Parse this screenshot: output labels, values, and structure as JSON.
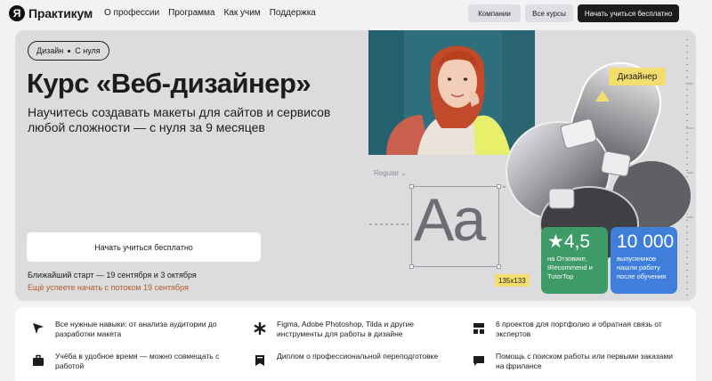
{
  "header": {
    "logo_mark": "Я",
    "logo_text": "Практикум",
    "nav": [
      "О профессии",
      "Программа",
      "Как учим",
      "Поддержка"
    ],
    "buttons": {
      "companies": "Компании",
      "all_courses": "Все курсы",
      "start_free": "Начать учиться бесплатно"
    }
  },
  "hero": {
    "badge": {
      "part1": "Дизайн",
      "part2": "С нуля"
    },
    "title": "Курс «Веб-дизайнер»",
    "subtitle": "Научитесь создавать макеты для сайтов и сервисов любой сложности — с нуля за 9 месяцев",
    "cta": "Начать учиться бесплатно",
    "nearest_start": "Ближайший старт — 19 сентября и 3 октября",
    "late_start": "Ещё успеете начать с потоком 19 сентября",
    "font_style": "Regular",
    "sample_text": "Aa",
    "dimensions": "135x133",
    "designer_tag": "Дизайнер",
    "rating": {
      "value": "4,5",
      "caption": "на Отзовике, IRecommend и TutorTop",
      "color": "#3e9a66"
    },
    "graduates": {
      "value": "10 000",
      "caption": "выпускников нашли работу после обучения",
      "color": "#3f7fdb"
    },
    "accent_color": "#f3de6d"
  },
  "features": [
    {
      "icon": "cursor-arrow-icon",
      "text": "Все нужные навыки: от анализа аудитории до разработки макета"
    },
    {
      "icon": "asterisk-icon",
      "text": "Figma, Adobe Photoshop, Tilda и другие инструменты для работы в дизайне"
    },
    {
      "icon": "layout-grid-icon",
      "text": "6 проектов для портфолио и обратная связь от экспертов"
    },
    {
      "icon": "briefcase-icon",
      "text": "Учёба в удобное время — можно совмещать с работой"
    },
    {
      "icon": "diploma-icon",
      "text": "Диплом о профессиональной переподготовке"
    },
    {
      "icon": "chat-bubble-icon",
      "text": "Помощь с поиском работы или первыми заказами на фрилансе"
    }
  ]
}
